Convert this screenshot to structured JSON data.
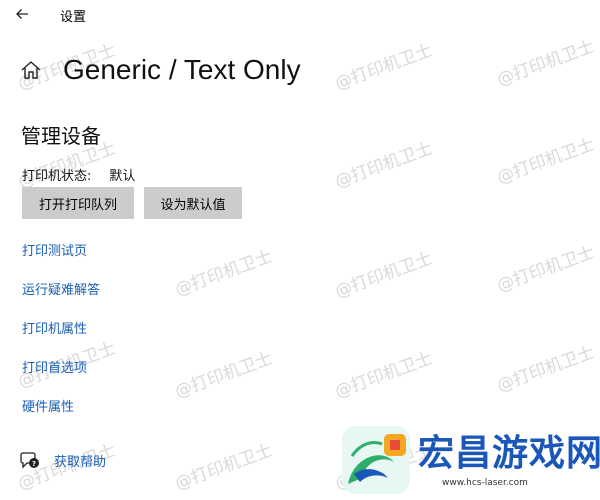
{
  "window": {
    "title": "设置"
  },
  "page": {
    "title": "Generic / Text Only"
  },
  "section": {
    "title": "管理设备"
  },
  "status": {
    "label": "打印机状态:",
    "value": "默认"
  },
  "buttons": {
    "open_queue": "打开打印队列",
    "set_default": "设为默认值"
  },
  "links": [
    "打印测试页",
    "运行疑难解答",
    "打印机属性",
    "打印首选项",
    "硬件属性"
  ],
  "help": {
    "label": "获取帮助"
  },
  "watermark": {
    "text": "@打印机卫士"
  },
  "logo": {
    "text": "宏昌游戏网",
    "url": "www.hcs-laser.com"
  },
  "colors": {
    "link": "#1a5fb4",
    "button_bg": "#cccccc",
    "logo_blue": "#1b57b8",
    "logo_green": "#2fae6a"
  },
  "icons": {
    "back": "arrow-left-icon",
    "home": "home-icon",
    "help": "chat-help-icon"
  }
}
